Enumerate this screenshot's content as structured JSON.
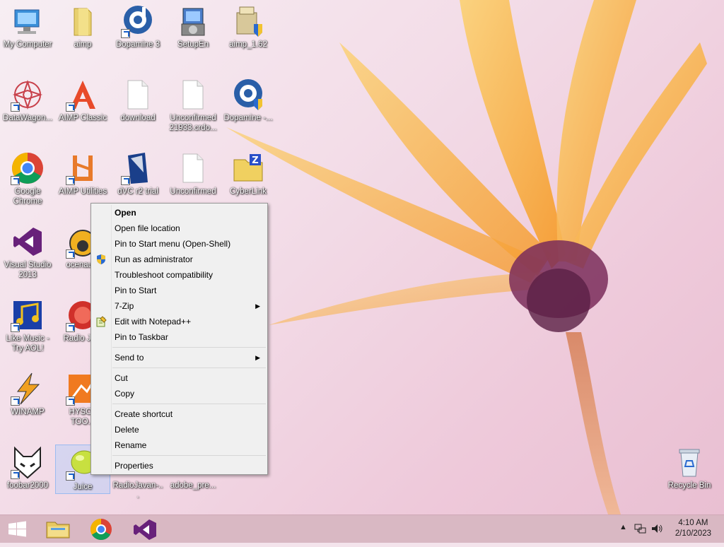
{
  "desktop": {
    "icons": [
      {
        "label": "My Computer"
      },
      {
        "label": "aimp"
      },
      {
        "label": "Dopamine 3"
      },
      {
        "label": "SetupEn"
      },
      {
        "label": "aimp_1.62"
      },
      {
        "label": "DataWagon..."
      },
      {
        "label": "AIMP Classic"
      },
      {
        "label": "download"
      },
      {
        "label": "Unconfirmed 21933.crdo..."
      },
      {
        "label": "Dopamine -..."
      },
      {
        "label": "Google Chrome"
      },
      {
        "label": "AIMP Utilities"
      },
      {
        "label": "dVC r2 trial"
      },
      {
        "label": "Unconfirmed"
      },
      {
        "label": "CyberLink"
      },
      {
        "label": "Visual Studio 2013"
      },
      {
        "label": "ocenau..."
      },
      {
        "label": "Like Music - Try AOL!"
      },
      {
        "label": "Radio Ja..."
      },
      {
        "label": "WINAMP"
      },
      {
        "label": "HYSOL TOO..."
      },
      {
        "label": "foobar2000"
      },
      {
        "label": "Juice"
      },
      {
        "label": "RadioJavan-..."
      },
      {
        "label": "adobe_pre..."
      },
      {
        "label": "Recycle Bin"
      }
    ]
  },
  "context_menu": {
    "items": [
      {
        "label": "Open"
      },
      {
        "label": "Open file location"
      },
      {
        "label": "Pin to Start menu (Open-Shell)"
      },
      {
        "label": "Run as administrator"
      },
      {
        "label": "Troubleshoot compatibility"
      },
      {
        "label": "Pin to Start"
      },
      {
        "label": "7-Zip"
      },
      {
        "label": "Edit with Notepad++"
      },
      {
        "label": "Pin to Taskbar"
      },
      {
        "label": "Send to"
      },
      {
        "label": "Cut"
      },
      {
        "label": "Copy"
      },
      {
        "label": "Create shortcut"
      },
      {
        "label": "Delete"
      },
      {
        "label": "Rename"
      },
      {
        "label": "Properties"
      }
    ]
  },
  "taskbar": {
    "pinned": [
      "start-icon",
      "file-explorer-icon",
      "chrome-icon",
      "visual-studio-icon"
    ],
    "time": "4:10 AM",
    "date": "2/10/2023"
  },
  "colors": {
    "petal": "#f7a73a",
    "flower_center": "#6d2a52",
    "taskbar": "#d9b8c3"
  }
}
